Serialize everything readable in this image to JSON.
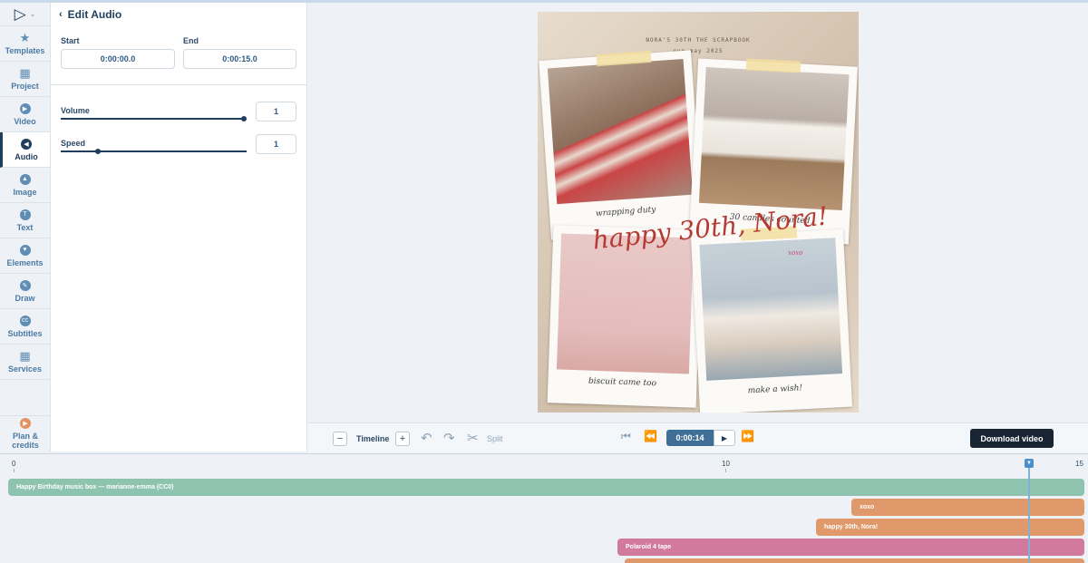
{
  "colors": {
    "accent": "#1f3d5c",
    "audio_track": "#8ec3b0",
    "text_track": "#e0996a",
    "image_track": "#d27a9e",
    "download_button": "#1a2533"
  },
  "sidebar": {
    "items": [
      {
        "label": "Templates",
        "icon": "star-icon",
        "active": false
      },
      {
        "label": "Project",
        "icon": "grid-icon",
        "active": false
      },
      {
        "label": "Video",
        "icon": "play-icon",
        "active": false
      },
      {
        "label": "Audio",
        "icon": "audio-icon",
        "active": true
      },
      {
        "label": "Image",
        "icon": "image-icon",
        "active": false
      },
      {
        "label": "Text",
        "icon": "text-icon",
        "active": false
      },
      {
        "label": "Elements",
        "icon": "heart-icon",
        "active": false
      },
      {
        "label": "Draw",
        "icon": "pencil-icon",
        "active": false
      },
      {
        "label": "Subtitles",
        "icon": "cc-icon",
        "active": false
      },
      {
        "label": "Services",
        "icon": "grid-icon",
        "active": false
      }
    ],
    "plan_line1": "Plan &",
    "plan_line2": "credits"
  },
  "panel": {
    "title": "Edit Audio",
    "start_label": "Start",
    "start_value": "0:00:00.0",
    "end_label": "End",
    "end_value": "0:00:15.0",
    "volume_label": "Volume",
    "volume_value": "1",
    "volume_fraction": 1.0,
    "speed_label": "Speed",
    "speed_value": "1",
    "speed_fraction": 0.2
  },
  "canvas": {
    "header_line1": "NORA'S 30TH    THE SCRAPBOOK",
    "header_line2": "ove   may 2025",
    "caption_1": "wrapping duty",
    "caption_2": "30 candles counted",
    "caption_3": "biscuit came too",
    "caption_4": "make a wish!",
    "headline": "happy 30th, Nora!",
    "tag": "xoxo"
  },
  "toolbar": {
    "zoom_out": "−",
    "timeline_label": "Timeline",
    "zoom_in": "+",
    "split_label": "Split",
    "current_time": "0:00:14",
    "download_label": "Download video"
  },
  "timeline": {
    "ticks": [
      "0",
      "10",
      "15"
    ],
    "tracks": [
      {
        "label": "Happy Birthday music box — marianne-emma (CC0)",
        "start": 0,
        "end": 15,
        "kind": "audio"
      },
      {
        "label": "xoxo",
        "start": 11.8,
        "end": 15,
        "kind": "text"
      },
      {
        "label": "happy 30th, Nora!",
        "start": 11.3,
        "end": 15,
        "kind": "text"
      },
      {
        "label": "Polaroid 4 tape",
        "start": 8.5,
        "end": 15,
        "kind": "image"
      },
      {
        "label": "",
        "start": 8.6,
        "end": 15,
        "kind": "text"
      }
    ],
    "playhead_time": 14.3
  }
}
